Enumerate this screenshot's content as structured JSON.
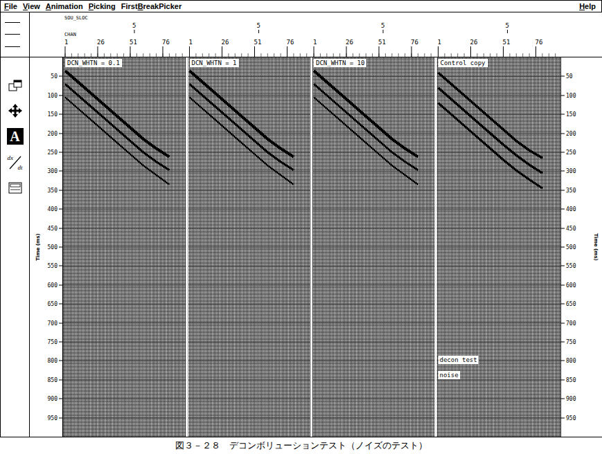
{
  "menu": [
    {
      "label": "File",
      "mnemonic": "F"
    },
    {
      "label": "View",
      "mnemonic": "V"
    },
    {
      "label": "Animation",
      "mnemonic": "A"
    },
    {
      "label": "Picking",
      "mnemonic": "P"
    },
    {
      "label": "FirstBreakPicker",
      "mnemonic": "B"
    }
  ],
  "help": {
    "label": "Help",
    "mnemonic": "H"
  },
  "toolbar": [
    {
      "kind": "windows",
      "selected": false
    },
    {
      "kind": "move",
      "selected": false
    },
    {
      "kind": "text",
      "label": "A",
      "selected": true
    },
    {
      "kind": "derivative",
      "top": "dx",
      "bottom": "dt",
      "selected": false
    },
    {
      "kind": "zoom",
      "selected": false
    }
  ],
  "header": {
    "source_label": "SOU_SLOC",
    "channel_label": "CHAN"
  },
  "axis": {
    "title": "Time (ms)",
    "ticks": [
      "50",
      "100",
      "150",
      "200",
      "250",
      "300",
      "350",
      "400",
      "450",
      "500",
      "550",
      "600",
      "650",
      "700",
      "750",
      "800",
      "850",
      "900",
      "950"
    ]
  },
  "panels": [
    {
      "label": "DCN_WHTN = 0.1",
      "sou_sloc": "5",
      "channel_ticks": [
        "1",
        "26",
        "51",
        "76"
      ],
      "notes": [],
      "events": [
        {
          "amplitude": 1,
          "channels": [
            1,
            11,
            21,
            31,
            41,
            51,
            61,
            71,
            81
          ],
          "times_ms": [
            35,
            65,
            95,
            125,
            155,
            185,
            215,
            240,
            262
          ]
        },
        {
          "amplitude": 0.7,
          "channels": [
            1,
            11,
            21,
            31,
            41,
            51,
            61,
            71,
            81
          ],
          "times_ms": [
            70,
            100,
            130,
            160,
            190,
            220,
            250,
            275,
            297
          ]
        },
        {
          "amplitude": 0.4,
          "channels": [
            1,
            11,
            21,
            31,
            41,
            51,
            61,
            71,
            81
          ],
          "times_ms": [
            105,
            135,
            165,
            195,
            225,
            255,
            285,
            310,
            335
          ]
        }
      ]
    },
    {
      "label": "DCN_WHTN = 1",
      "sou_sloc": "5",
      "channel_ticks": [
        "1",
        "26",
        "51",
        "76"
      ],
      "notes": [],
      "events": [
        {
          "amplitude": 1,
          "channels": [
            1,
            11,
            21,
            31,
            41,
            51,
            61,
            71,
            81
          ],
          "times_ms": [
            35,
            65,
            95,
            125,
            155,
            185,
            215,
            240,
            262
          ]
        },
        {
          "amplitude": 0.7,
          "channels": [
            1,
            11,
            21,
            31,
            41,
            51,
            61,
            71,
            81
          ],
          "times_ms": [
            70,
            100,
            130,
            160,
            190,
            220,
            250,
            275,
            297
          ]
        },
        {
          "amplitude": 0.4,
          "channels": [
            1,
            11,
            21,
            31,
            41,
            51,
            61,
            71,
            81
          ],
          "times_ms": [
            105,
            135,
            165,
            195,
            225,
            255,
            285,
            310,
            335
          ]
        }
      ]
    },
    {
      "label": "DCN_WHTN = 10",
      "sou_sloc": "5",
      "channel_ticks": [
        "1",
        "26",
        "51",
        "76"
      ],
      "notes": [],
      "events": [
        {
          "amplitude": 1,
          "channels": [
            1,
            11,
            21,
            31,
            41,
            51,
            61,
            71,
            81
          ],
          "times_ms": [
            35,
            65,
            95,
            125,
            155,
            185,
            215,
            240,
            262
          ]
        },
        {
          "amplitude": 0.6,
          "channels": [
            1,
            11,
            21,
            31,
            41,
            51,
            61,
            71,
            81
          ],
          "times_ms": [
            70,
            100,
            130,
            160,
            190,
            220,
            250,
            275,
            297
          ]
        },
        {
          "amplitude": 0.4,
          "channels": [
            1,
            11,
            21,
            31,
            41,
            51,
            61,
            71,
            81
          ],
          "times_ms": [
            105,
            135,
            165,
            195,
            225,
            255,
            285,
            310,
            335
          ]
        }
      ]
    },
    {
      "label": "Control copy",
      "sou_sloc": "5",
      "channel_ticks": [
        "1",
        "26",
        "51",
        "76"
      ],
      "notes": [
        "decon test",
        "noise"
      ],
      "events": [
        {
          "amplitude": 0.8,
          "channels": [
            1,
            11,
            21,
            31,
            41,
            51,
            61,
            71,
            81
          ],
          "times_ms": [
            40,
            70,
            100,
            130,
            160,
            190,
            220,
            245,
            265
          ]
        },
        {
          "amplitude": 0.8,
          "channels": [
            1,
            11,
            21,
            31,
            41,
            51,
            61,
            71,
            81
          ],
          "times_ms": [
            80,
            110,
            140,
            170,
            200,
            230,
            258,
            283,
            305
          ]
        },
        {
          "amplitude": 0.7,
          "channels": [
            1,
            11,
            21,
            31,
            41,
            51,
            61,
            71,
            81
          ],
          "times_ms": [
            120,
            150,
            180,
            210,
            240,
            270,
            298,
            322,
            345
          ]
        }
      ]
    }
  ],
  "caption": "図３－２８　デコンボリューションテスト（ノイズのテスト）"
}
